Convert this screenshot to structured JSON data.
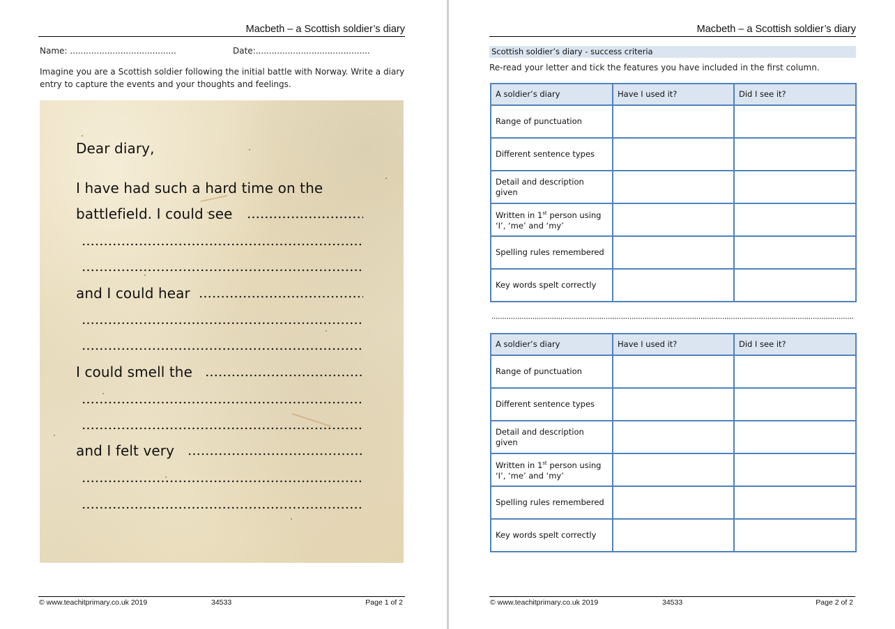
{
  "doc_title": "Macbeth – a Scottish soldier’s diary",
  "page1": {
    "name_label": "Name: ........................................",
    "date_label": "Date:...........................................",
    "intro": "Imagine you are a Scottish soldier following the initial battle with Norway. Write a diary entry to capture the events and your thoughts and feelings.",
    "diary": {
      "greeting": "Dear diary,",
      "line1": "I have had such a hard time on the",
      "line2": "battlefield. I could see",
      "prompt_hear": "and I could hear",
      "prompt_smell": "I could smell the",
      "prompt_felt": "and I felt very"
    },
    "footer": {
      "copyright": "© www.teachitprimary.co.uk 2019",
      "code": "34533",
      "page": "Page 1 of 2"
    }
  },
  "page2": {
    "section_title": "Scottish soldier’s diary - success criteria",
    "instruction": "Re-read your letter and tick the features you have included in the first column.",
    "table_headers": [
      "A soldier’s diary",
      "Have I used it?",
      "Did I see it?"
    ],
    "criteria": [
      "Range of punctuation",
      "Different sentence types",
      "Detail and description given",
      "Written in 1st person using ‘I’, ‘me’ and ‘my’",
      "Spelling rules remembered",
      "Key words spelt correctly"
    ],
    "criteria_parts": {
      "written_pre": "Written in 1",
      "written_sup": "st",
      "written_post": " person using ‘I’, ‘me’ and ‘my’"
    },
    "footer": {
      "copyright": "© www.teachitprimary.co.uk 2019",
      "code": "34533",
      "page": "Page 2 of 2"
    }
  },
  "colors": {
    "table_border": "#4f81bd",
    "table_header_fill": "#dbe5f1",
    "section_title_fill": "#dbe5f1",
    "parchment": "#e8dcbd"
  }
}
